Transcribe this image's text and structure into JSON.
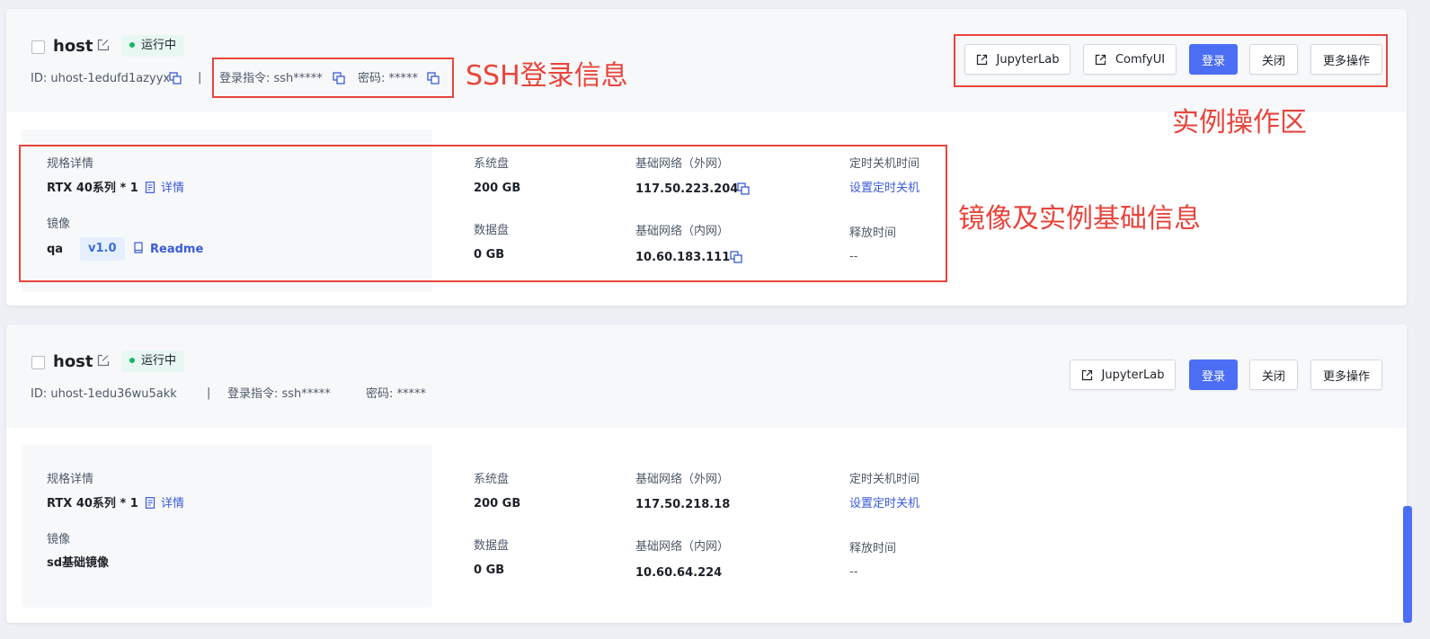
{
  "colors": {
    "primary": "#4c6ef5",
    "status_dot": "#18b566",
    "annotation": "#e8453c",
    "link": "#3a5bd9"
  },
  "annotations": {
    "ssh": "SSH登录信息",
    "actions": "实例操作区",
    "info": "镜像及实例基础信息"
  },
  "instances": [
    {
      "name": "host",
      "status": "运行中",
      "id": "ID: uhost-1edufd1azyyx",
      "separator": "|",
      "login_cmd": "登录指令: ssh*****",
      "password": "密码: *****",
      "buttons": {
        "jupyterlab": "JupyterLab",
        "comfyui": "ComfyUI",
        "login": "登录",
        "close": "关闭",
        "more": "更多操作"
      },
      "spec_label": "规格详情",
      "spec_value": "RTX 40系列 * 1",
      "detail_link": "详情",
      "image_label": "镜像",
      "image_name": "qa",
      "image_version": "v1.0",
      "readme_link": "Readme",
      "sys_disk_label": "系统盘",
      "sys_disk_value": "200 GB",
      "data_disk_label": "数据盘",
      "data_disk_value": "0 GB",
      "net_ext_label": "基础网络（外网）",
      "net_ext_value": "117.50.223.204",
      "net_int_label": "基础网络（内网）",
      "net_int_value": "10.60.183.111",
      "shutdown_label": "定时关机时间",
      "shutdown_link": "设置定时关机",
      "release_label": "释放时间",
      "release_value": "--"
    },
    {
      "name": "host",
      "status": "运行中",
      "id": "ID: uhost-1edu36wu5akk",
      "separator": "|",
      "login_cmd": "登录指令: ssh*****",
      "password": "密码: *****",
      "buttons": {
        "jupyterlab": "JupyterLab",
        "login": "登录",
        "close": "关闭",
        "more": "更多操作"
      },
      "spec_label": "规格详情",
      "spec_value": "RTX 40系列 * 1",
      "detail_link": "详情",
      "image_label": "镜像",
      "image_name": "sd基础镜像",
      "sys_disk_label": "系统盘",
      "sys_disk_value": "200 GB",
      "data_disk_label": "数据盘",
      "data_disk_value": "0 GB",
      "net_ext_label": "基础网络（外网）",
      "net_ext_value": "117.50.218.18",
      "net_int_label": "基础网络（内网）",
      "net_int_value": "10.60.64.224",
      "shutdown_label": "定时关机时间",
      "shutdown_link": "设置定时关机",
      "release_label": "释放时间",
      "release_value": "--"
    }
  ]
}
